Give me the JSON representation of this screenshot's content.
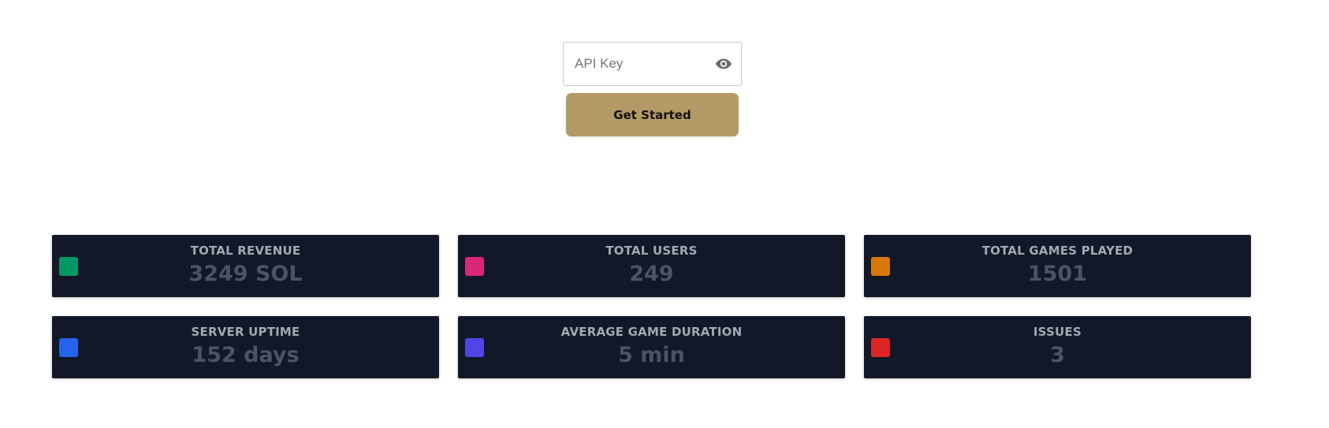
{
  "auth": {
    "api_key_placeholder": "API Key",
    "api_key_value": "",
    "toggle_icon": "eye-icon",
    "submit_label": "Get Started",
    "button_color": "#b39a66"
  },
  "stats": [
    {
      "title": "TOTAL REVENUE",
      "value": "3249 SOL",
      "color": "#019863"
    },
    {
      "title": "TOTAL USERS",
      "value": "249",
      "color": "#db2777"
    },
    {
      "title": "TOTAL GAMES PLAYED",
      "value": "1501",
      "color": "#d97706"
    },
    {
      "title": "SERVER UPTIME",
      "value": "152 days",
      "color": "#2563eb"
    },
    {
      "title": "AVERAGE GAME DURATION",
      "value": "5 min",
      "color": "#4f46e5"
    },
    {
      "title": "ISSUES",
      "value": "3",
      "color": "#dc2626"
    }
  ],
  "theme": {
    "card_background": "#121827",
    "card_title_color": "#a3a9b4",
    "card_value_color": "#4b5463"
  }
}
